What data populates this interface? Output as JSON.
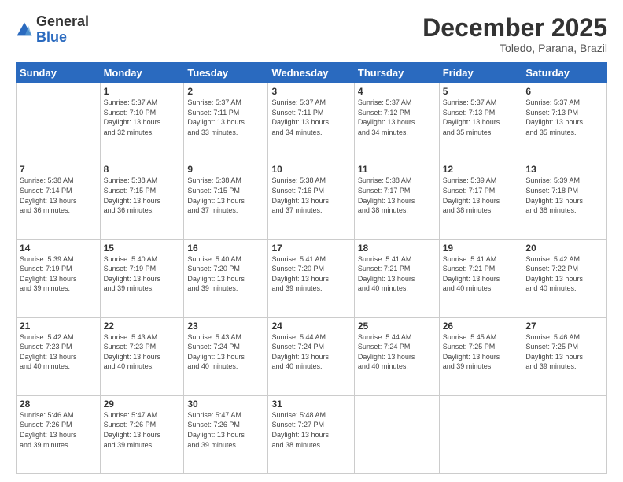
{
  "logo": {
    "general": "General",
    "blue": "Blue"
  },
  "header": {
    "month": "December 2025",
    "location": "Toledo, Parana, Brazil"
  },
  "days_of_week": [
    "Sunday",
    "Monday",
    "Tuesday",
    "Wednesday",
    "Thursday",
    "Friday",
    "Saturday"
  ],
  "weeks": [
    [
      {
        "day": "",
        "info": ""
      },
      {
        "day": "1",
        "info": "Sunrise: 5:37 AM\nSunset: 7:10 PM\nDaylight: 13 hours\nand 32 minutes."
      },
      {
        "day": "2",
        "info": "Sunrise: 5:37 AM\nSunset: 7:11 PM\nDaylight: 13 hours\nand 33 minutes."
      },
      {
        "day": "3",
        "info": "Sunrise: 5:37 AM\nSunset: 7:11 PM\nDaylight: 13 hours\nand 34 minutes."
      },
      {
        "day": "4",
        "info": "Sunrise: 5:37 AM\nSunset: 7:12 PM\nDaylight: 13 hours\nand 34 minutes."
      },
      {
        "day": "5",
        "info": "Sunrise: 5:37 AM\nSunset: 7:13 PM\nDaylight: 13 hours\nand 35 minutes."
      },
      {
        "day": "6",
        "info": "Sunrise: 5:37 AM\nSunset: 7:13 PM\nDaylight: 13 hours\nand 35 minutes."
      }
    ],
    [
      {
        "day": "7",
        "info": "Sunrise: 5:38 AM\nSunset: 7:14 PM\nDaylight: 13 hours\nand 36 minutes."
      },
      {
        "day": "8",
        "info": "Sunrise: 5:38 AM\nSunset: 7:15 PM\nDaylight: 13 hours\nand 36 minutes."
      },
      {
        "day": "9",
        "info": "Sunrise: 5:38 AM\nSunset: 7:15 PM\nDaylight: 13 hours\nand 37 minutes."
      },
      {
        "day": "10",
        "info": "Sunrise: 5:38 AM\nSunset: 7:16 PM\nDaylight: 13 hours\nand 37 minutes."
      },
      {
        "day": "11",
        "info": "Sunrise: 5:38 AM\nSunset: 7:17 PM\nDaylight: 13 hours\nand 38 minutes."
      },
      {
        "day": "12",
        "info": "Sunrise: 5:39 AM\nSunset: 7:17 PM\nDaylight: 13 hours\nand 38 minutes."
      },
      {
        "day": "13",
        "info": "Sunrise: 5:39 AM\nSunset: 7:18 PM\nDaylight: 13 hours\nand 38 minutes."
      }
    ],
    [
      {
        "day": "14",
        "info": "Sunrise: 5:39 AM\nSunset: 7:19 PM\nDaylight: 13 hours\nand 39 minutes."
      },
      {
        "day": "15",
        "info": "Sunrise: 5:40 AM\nSunset: 7:19 PM\nDaylight: 13 hours\nand 39 minutes."
      },
      {
        "day": "16",
        "info": "Sunrise: 5:40 AM\nSunset: 7:20 PM\nDaylight: 13 hours\nand 39 minutes."
      },
      {
        "day": "17",
        "info": "Sunrise: 5:41 AM\nSunset: 7:20 PM\nDaylight: 13 hours\nand 39 minutes."
      },
      {
        "day": "18",
        "info": "Sunrise: 5:41 AM\nSunset: 7:21 PM\nDaylight: 13 hours\nand 40 minutes."
      },
      {
        "day": "19",
        "info": "Sunrise: 5:41 AM\nSunset: 7:21 PM\nDaylight: 13 hours\nand 40 minutes."
      },
      {
        "day": "20",
        "info": "Sunrise: 5:42 AM\nSunset: 7:22 PM\nDaylight: 13 hours\nand 40 minutes."
      }
    ],
    [
      {
        "day": "21",
        "info": "Sunrise: 5:42 AM\nSunset: 7:23 PM\nDaylight: 13 hours\nand 40 minutes."
      },
      {
        "day": "22",
        "info": "Sunrise: 5:43 AM\nSunset: 7:23 PM\nDaylight: 13 hours\nand 40 minutes."
      },
      {
        "day": "23",
        "info": "Sunrise: 5:43 AM\nSunset: 7:24 PM\nDaylight: 13 hours\nand 40 minutes."
      },
      {
        "day": "24",
        "info": "Sunrise: 5:44 AM\nSunset: 7:24 PM\nDaylight: 13 hours\nand 40 minutes."
      },
      {
        "day": "25",
        "info": "Sunrise: 5:44 AM\nSunset: 7:24 PM\nDaylight: 13 hours\nand 40 minutes."
      },
      {
        "day": "26",
        "info": "Sunrise: 5:45 AM\nSunset: 7:25 PM\nDaylight: 13 hours\nand 39 minutes."
      },
      {
        "day": "27",
        "info": "Sunrise: 5:46 AM\nSunset: 7:25 PM\nDaylight: 13 hours\nand 39 minutes."
      }
    ],
    [
      {
        "day": "28",
        "info": "Sunrise: 5:46 AM\nSunset: 7:26 PM\nDaylight: 13 hours\nand 39 minutes."
      },
      {
        "day": "29",
        "info": "Sunrise: 5:47 AM\nSunset: 7:26 PM\nDaylight: 13 hours\nand 39 minutes."
      },
      {
        "day": "30",
        "info": "Sunrise: 5:47 AM\nSunset: 7:26 PM\nDaylight: 13 hours\nand 39 minutes."
      },
      {
        "day": "31",
        "info": "Sunrise: 5:48 AM\nSunset: 7:27 PM\nDaylight: 13 hours\nand 38 minutes."
      },
      {
        "day": "",
        "info": ""
      },
      {
        "day": "",
        "info": ""
      },
      {
        "day": "",
        "info": ""
      }
    ]
  ]
}
